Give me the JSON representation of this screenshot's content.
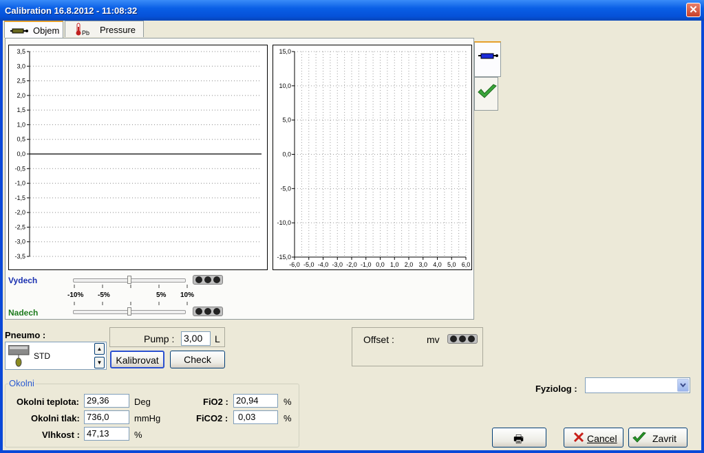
{
  "window": {
    "title": "Calibration 16.8.2012 - 11:08:32",
    "close_glyph": "✕"
  },
  "tabs": [
    {
      "label": "Objem",
      "icon": "syringe-icon"
    },
    {
      "label": "Pressure",
      "icon": "thermometer-icon",
      "icon_text": "Pb"
    }
  ],
  "left_chart": {
    "type": "line",
    "y_ticks": [
      "3,5",
      "3,0",
      "2,5",
      "2,0",
      "1,5",
      "1,0",
      "0,5",
      "0,0",
      "-0,5",
      "-1,0",
      "-1,5",
      "-2,0",
      "-2,5",
      "-3,0",
      "-3,5"
    ],
    "ylim": [
      -3.5,
      3.5
    ],
    "series": [
      {
        "x": [
          0,
          1
        ],
        "y": [
          0,
          0
        ]
      }
    ],
    "grid": true
  },
  "right_chart": {
    "type": "scatter",
    "y_ticks": [
      "15,0",
      "10,0",
      "5,0",
      "0,0",
      "-5,0",
      "-10,0",
      "-15,0"
    ],
    "x_ticks": [
      "-6,0",
      "-5,0",
      "-4,0",
      "-3,0",
      "-2,0",
      "-1,0",
      "0,0",
      "1,0",
      "2,0",
      "3,0",
      "4,0",
      "5,0",
      "6,0"
    ],
    "xlim": [
      -6,
      6
    ],
    "ylim": [
      -15,
      15
    ],
    "grid": true
  },
  "chart_data": [
    {
      "type": "line",
      "ylim": [
        -3.5,
        3.5
      ],
      "y_ticks": [
        "3,5",
        "3,0",
        "2,5",
        "2,0",
        "1,5",
        "1,0",
        "0,5",
        "0,0",
        "-0,5",
        "-1,0",
        "-1,5",
        "-2,0",
        "-2,5",
        "-3,0",
        "-3,5"
      ],
      "series": [
        {
          "x": [
            0,
            1
          ],
          "y": [
            0,
            0
          ]
        }
      ],
      "grid": true
    },
    {
      "type": "scatter",
      "xlim": [
        -6,
        6
      ],
      "ylim": [
        -15,
        15
      ],
      "x_ticks": [
        "-6,0",
        "-5,0",
        "-4,0",
        "-3,0",
        "-2,0",
        "-1,0",
        "0,0",
        "1,0",
        "2,0",
        "3,0",
        "4,0",
        "5,0",
        "6,0"
      ],
      "y_ticks": [
        "15,0",
        "10,0",
        "5,0",
        "0,0",
        "-5,0",
        "-10,0",
        "-15,0"
      ],
      "grid": true
    }
  ],
  "sliders": {
    "vydech_label": "Vydech",
    "nadech_label": "Nadech",
    "scale": [
      "-10%",
      "-5%",
      "5%",
      "10%"
    ],
    "vydech_value_percent": 0,
    "nadech_value_percent": 0
  },
  "side_tabs": [
    {
      "icon": "syringe-icon"
    },
    {
      "icon": "checkmark-icon"
    }
  ],
  "pneumo": {
    "label": "Pneumo :",
    "value": "STD"
  },
  "pump": {
    "label": "Pump :",
    "value": "3,00",
    "unit": "L"
  },
  "buttons": {
    "kalibrovat": "Kalibrovat",
    "check": "Check",
    "print_glyph": "🖶",
    "cancel": "Cancel",
    "zavrit": "Zavrit"
  },
  "offset": {
    "label": "Offset :",
    "unit": "mv"
  },
  "okolni": {
    "title": "Okolni",
    "teplota": {
      "label": "Okolni teplota:",
      "value": "29,36",
      "unit": "Deg"
    },
    "tlak": {
      "label": "Okolni tlak:",
      "value": "736,0",
      "unit": "mmHg"
    },
    "vlhkost": {
      "label": "Vlhkost :",
      "value": "47,13",
      "unit": "%"
    },
    "fio2": {
      "label": "FiO2 :",
      "value": "20,94",
      "unit": "%"
    },
    "fico2": {
      "label": "FiCO2 :",
      "value": "0,03",
      "unit": "%"
    }
  },
  "fyziolog": {
    "label": "Fyziolog :",
    "value": ""
  },
  "colors": {
    "title_blue": "#0a5fe6",
    "vydech": "#1a30b0",
    "nadech": "#1c7a1c",
    "check_green": "#3aa53a",
    "cancel_red": "#c8201a"
  }
}
